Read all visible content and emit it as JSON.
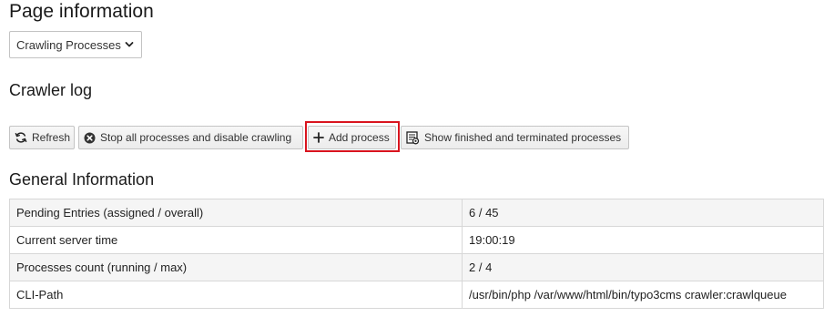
{
  "page": {
    "title": "Page information"
  },
  "view_select": {
    "selected": "Crawling Processes"
  },
  "crawler_log": {
    "title": "Crawler log",
    "buttons": {
      "refresh": "Refresh",
      "stop_all": "Stop all processes and disable crawling",
      "add_process": "Add process",
      "show_finished": "Show finished and terminated processes"
    }
  },
  "general_info": {
    "title": "General Information",
    "rows": [
      {
        "label": "Pending Entries (assigned / overall)",
        "value": "6 / 45"
      },
      {
        "label": "Current server time",
        "value": "19:00:19"
      },
      {
        "label": "Processes count (running / max)",
        "value": "2 / 4"
      },
      {
        "label": "CLI-Path",
        "value": "/usr/bin/php /var/www/html/bin/typo3cms crawler:crawlqueue"
      }
    ]
  },
  "icons": {
    "select_chevron": "chevron-down-icon",
    "refresh": "refresh-icon",
    "stop_all": "stop-circle-icon",
    "add_process": "plus-icon",
    "show_finished": "document-view-icon"
  },
  "colors": {
    "highlight": "#d9141e",
    "button_border": "#c4c4c4",
    "table_border": "#d7d7d7",
    "row_alt": "#f5f5f5"
  }
}
